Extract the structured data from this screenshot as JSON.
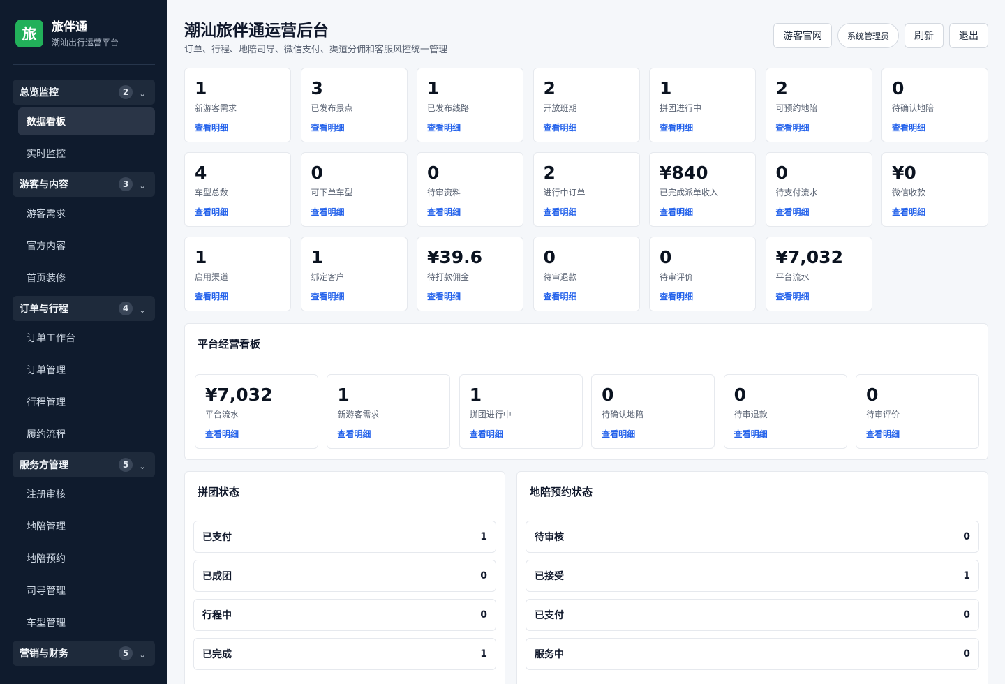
{
  "brand": {
    "logo": "旅",
    "name": "旅伴通",
    "subtitle": "潮汕出行运营平台"
  },
  "sidebar": {
    "groups": [
      {
        "label": "总览监控",
        "count": "2",
        "items": [
          "数据看板",
          "实时监控"
        ]
      },
      {
        "label": "游客与内容",
        "count": "3",
        "items": [
          "游客需求",
          "官方内容",
          "首页装修"
        ]
      },
      {
        "label": "订单与行程",
        "count": "4",
        "items": [
          "订单工作台",
          "订单管理",
          "行程管理",
          "履约流程"
        ]
      },
      {
        "label": "服务方管理",
        "count": "5",
        "items": [
          "注册审核",
          "地陪管理",
          "地陪预约",
          "司导管理",
          "车型管理"
        ]
      },
      {
        "label": "营销与财务",
        "count": "5",
        "items": []
      }
    ],
    "active_item": "数据看板"
  },
  "header": {
    "title": "潮汕旅伴通运营后台",
    "subtitle": "订单、行程、地陪司导、微信支付、渠道分佣和客服风控统一管理",
    "actions": {
      "visitor_site": "游客官网",
      "role": "系统管理员",
      "refresh": "刷新",
      "logout": "退出"
    }
  },
  "stats": [
    {
      "value": "1",
      "label": "新游客需求",
      "link": "查看明细"
    },
    {
      "value": "3",
      "label": "已发布景点",
      "link": "查看明细"
    },
    {
      "value": "1",
      "label": "已发布线路",
      "link": "查看明细"
    },
    {
      "value": "2",
      "label": "开放班期",
      "link": "查看明细"
    },
    {
      "value": "1",
      "label": "拼团进行中",
      "link": "查看明细"
    },
    {
      "value": "2",
      "label": "可预约地陪",
      "link": "查看明细"
    },
    {
      "value": "0",
      "label": "待确认地陪",
      "link": "查看明细"
    },
    {
      "value": "4",
      "label": "车型总数",
      "link": "查看明细"
    },
    {
      "value": "0",
      "label": "可下单车型",
      "link": "查看明细"
    },
    {
      "value": "0",
      "label": "待审资料",
      "link": "查看明细"
    },
    {
      "value": "2",
      "label": "进行中订单",
      "link": "查看明细"
    },
    {
      "value": "¥840",
      "label": "已完成派单收入",
      "link": "查看明细"
    },
    {
      "value": "0",
      "label": "待支付流水",
      "link": "查看明细"
    },
    {
      "value": "¥0",
      "label": "微信收款",
      "link": "查看明细"
    },
    {
      "value": "1",
      "label": "启用渠道",
      "link": "查看明细"
    },
    {
      "value": "1",
      "label": "绑定客户",
      "link": "查看明细"
    },
    {
      "value": "¥39.6",
      "label": "待打款佣金",
      "link": "查看明细"
    },
    {
      "value": "0",
      "label": "待审退款",
      "link": "查看明细"
    },
    {
      "value": "0",
      "label": "待审评价",
      "link": "查看明细"
    },
    {
      "value": "¥7,032",
      "label": "平台流水",
      "link": "查看明细"
    }
  ],
  "board": {
    "title": "平台经营看板",
    "cards": [
      {
        "value": "¥7,032",
        "label": "平台流水",
        "link": "查看明细"
      },
      {
        "value": "1",
        "label": "新游客需求",
        "link": "查看明细"
      },
      {
        "value": "1",
        "label": "拼团进行中",
        "link": "查看明细"
      },
      {
        "value": "0",
        "label": "待确认地陪",
        "link": "查看明细"
      },
      {
        "value": "0",
        "label": "待审退款",
        "link": "查看明细"
      },
      {
        "value": "0",
        "label": "待审评价",
        "link": "查看明细"
      }
    ]
  },
  "group_status": {
    "title": "拼团状态",
    "rows": [
      {
        "label": "已支付",
        "value": "1"
      },
      {
        "label": "已成团",
        "value": "0"
      },
      {
        "label": "行程中",
        "value": "0"
      },
      {
        "label": "已完成",
        "value": "1"
      }
    ]
  },
  "guide_status": {
    "title": "地陪预约状态",
    "rows": [
      {
        "label": "待审核",
        "value": "0"
      },
      {
        "label": "已接受",
        "value": "1"
      },
      {
        "label": "已支付",
        "value": "0"
      },
      {
        "label": "服务中",
        "value": "0"
      }
    ]
  }
}
